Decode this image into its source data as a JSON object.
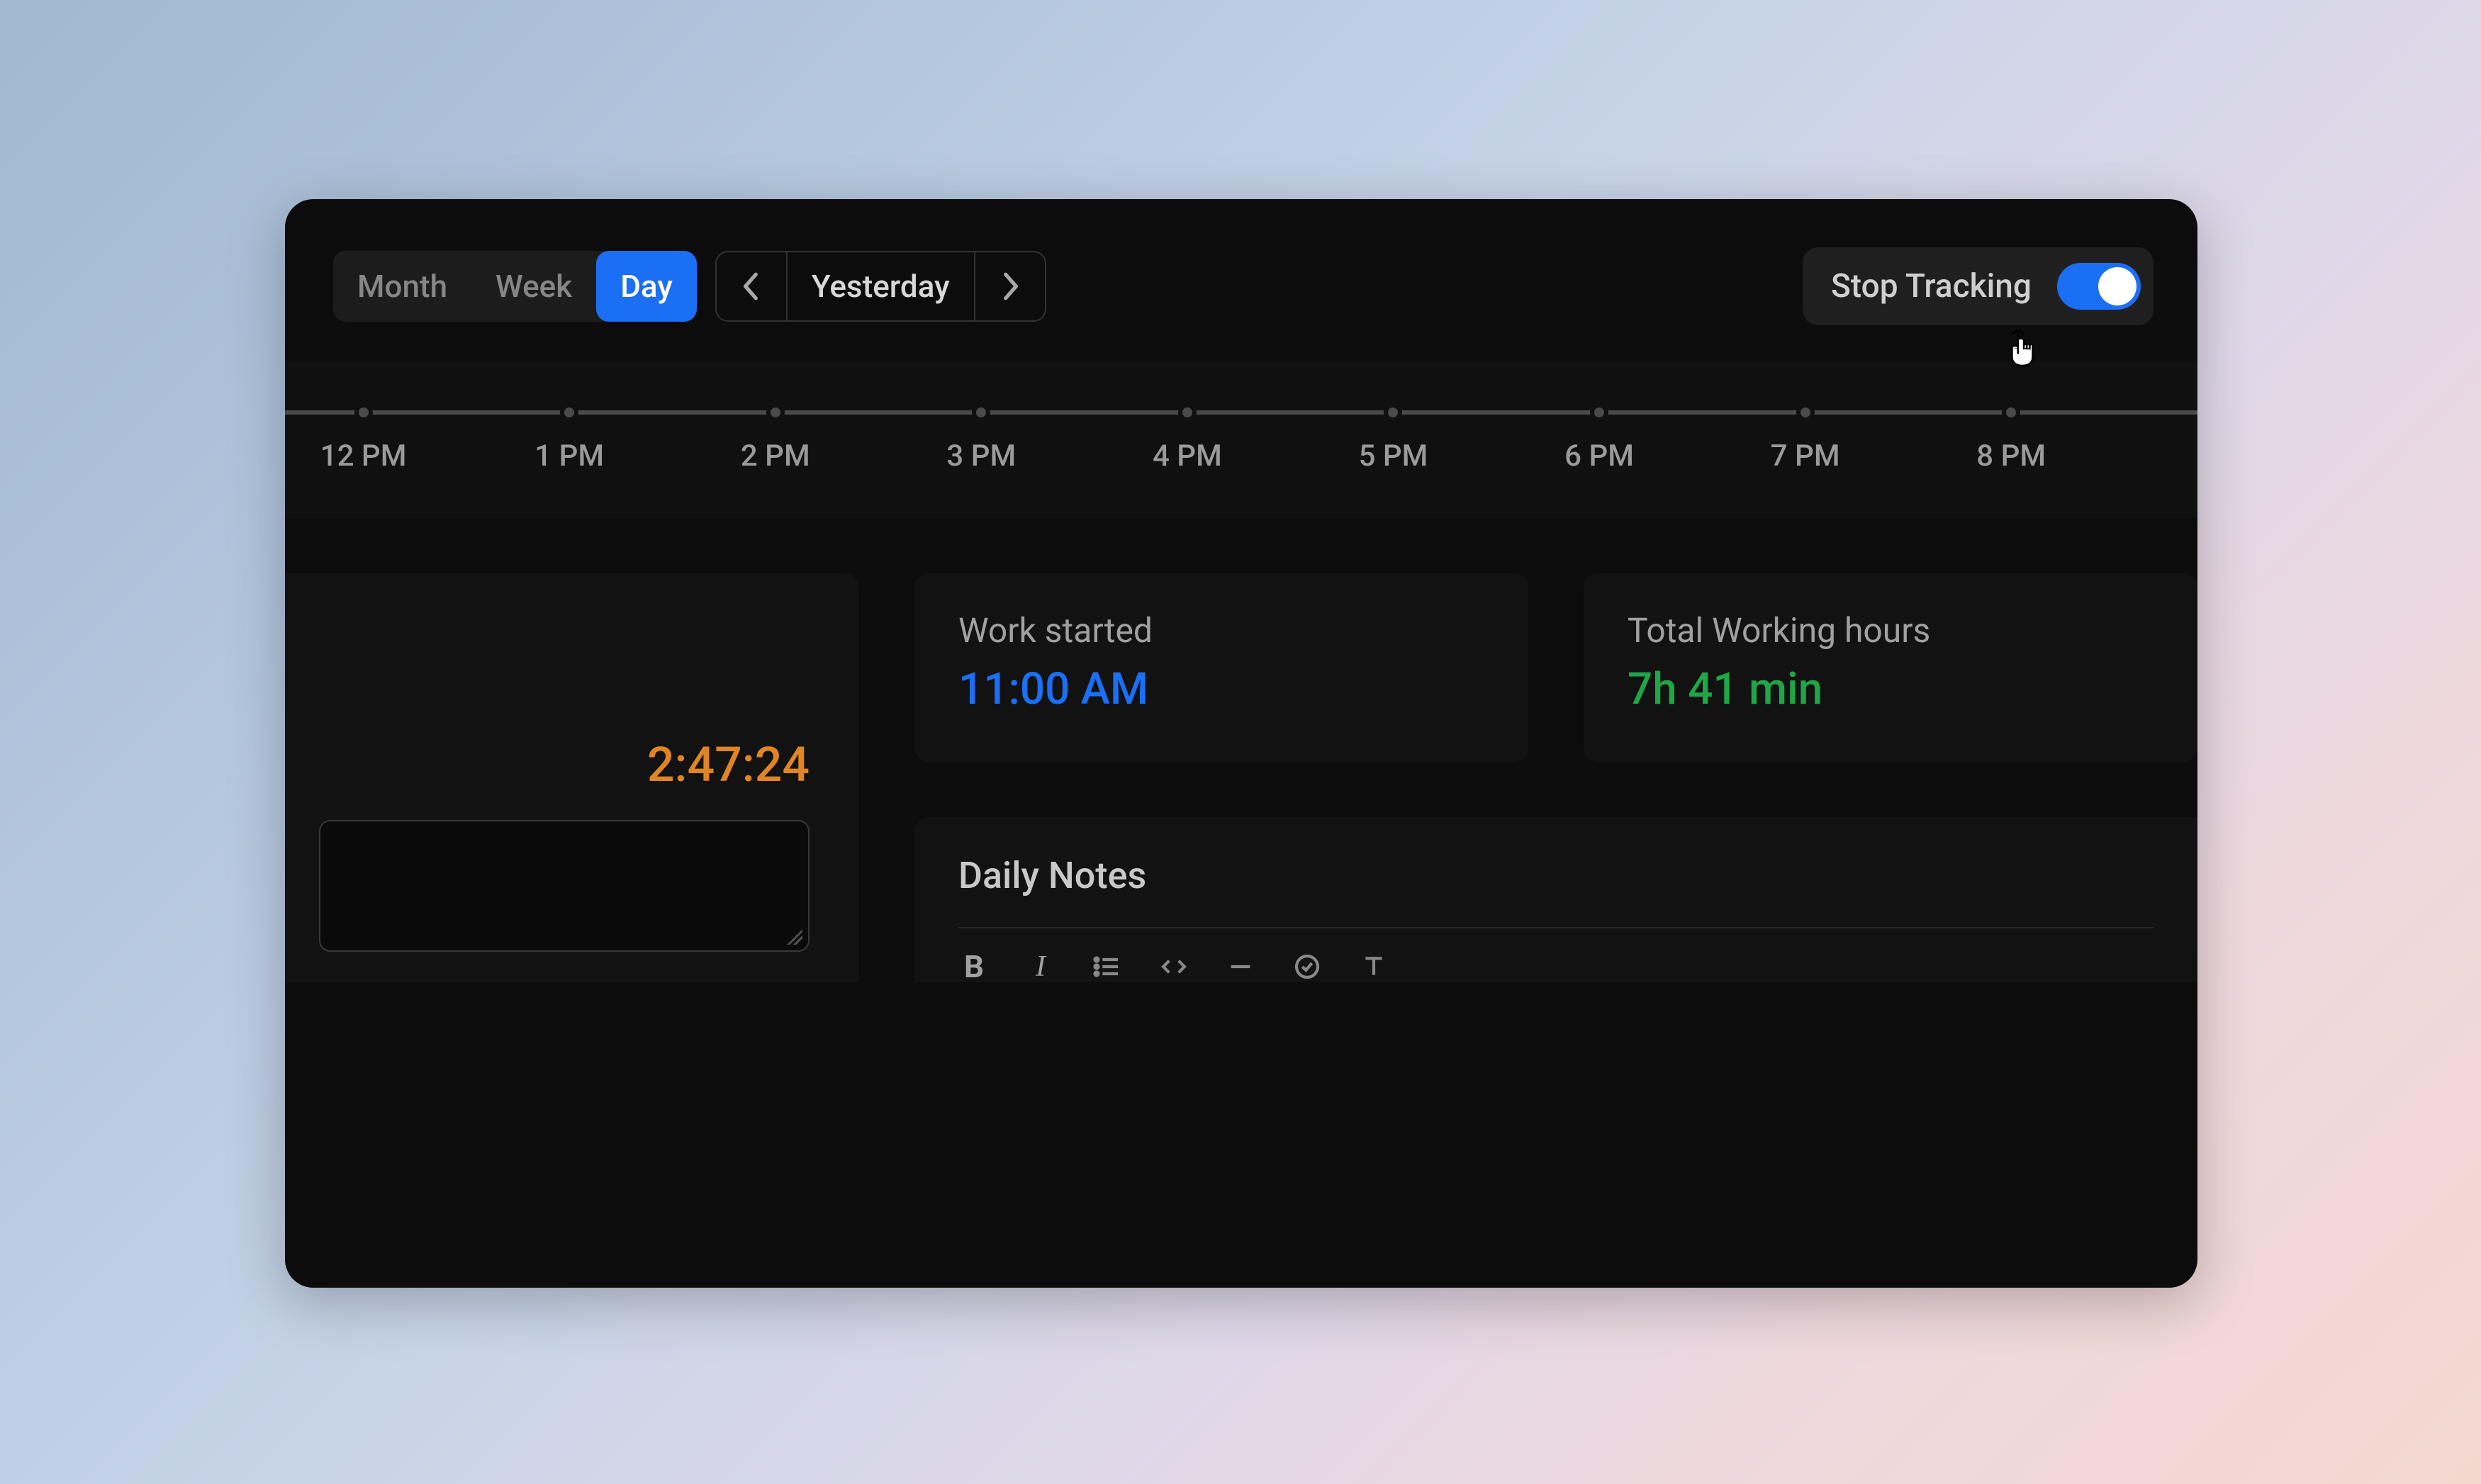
{
  "header": {
    "tabs": [
      {
        "label": "Month",
        "active": false
      },
      {
        "label": "Week",
        "active": false
      },
      {
        "label": "Day",
        "active": true
      }
    ],
    "date_label": "Yesterday",
    "tracking_label": "Stop Tracking",
    "tracking_on": true
  },
  "timeline": {
    "hours": [
      "12 PM",
      "1 PM",
      "2 PM",
      "3 PM",
      "4 PM",
      "5 PM",
      "6 PM",
      "7 PM",
      "8 PM"
    ],
    "positions_pct": [
      4.1,
      14.87,
      25.64,
      36.41,
      47.18,
      57.95,
      68.72,
      79.49,
      90.26
    ]
  },
  "timer": {
    "elapsed": "2:47:24"
  },
  "stats": {
    "work_started_label": "Work started",
    "work_started_value": "11:00 AM",
    "total_hours_label": "Total Working hours",
    "total_hours_value": "7h 41 min"
  },
  "notes": {
    "title": "Daily Notes"
  },
  "colors": {
    "accent": "#1b6ff5",
    "timer": "#e08524",
    "green": "#1fa647"
  }
}
